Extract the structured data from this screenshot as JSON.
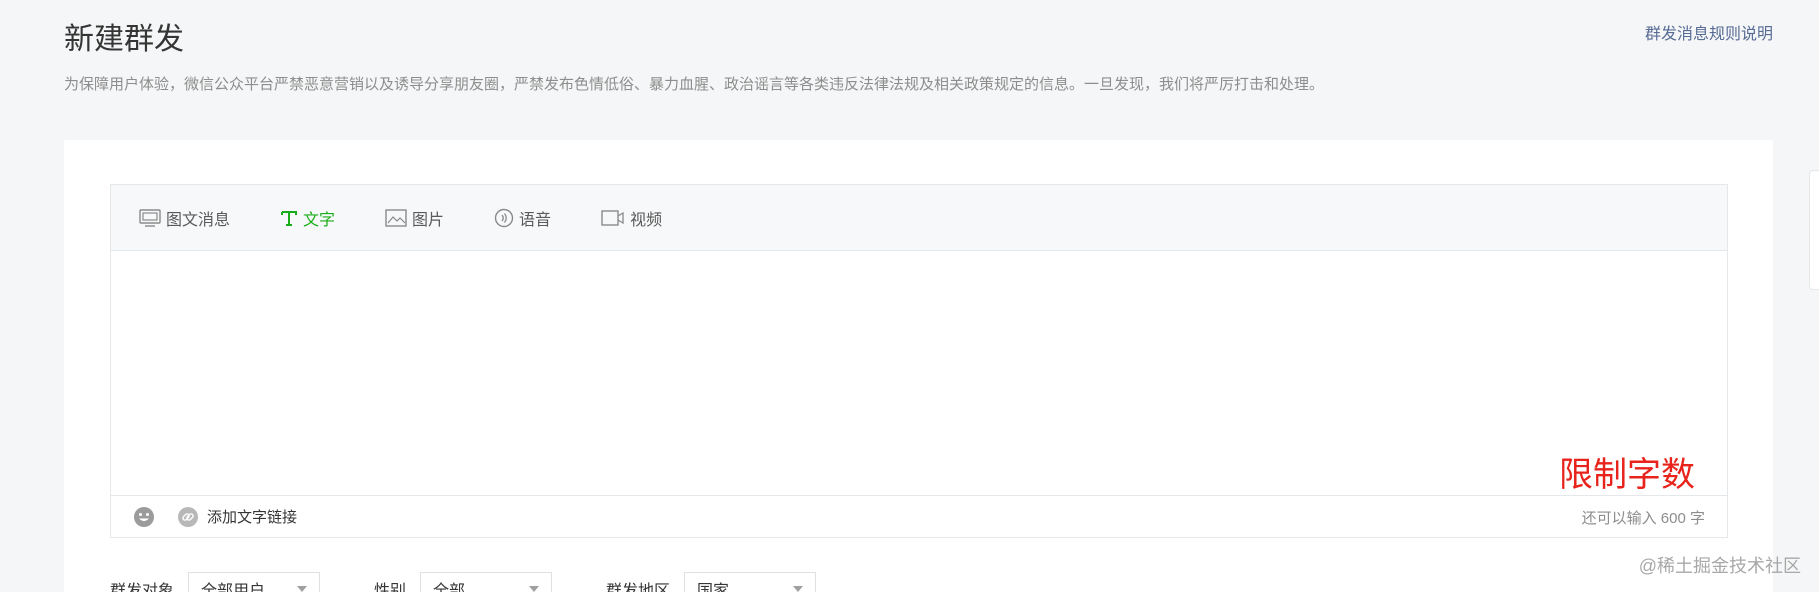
{
  "page": {
    "title": "新建群发",
    "rules_link": "群发消息规则说明",
    "notice": "为保障用户体验，微信公众平台严禁恶意营销以及诱导分享朋友圈，严禁发布色情低俗、暴力血腥、政治谣言等各类违反法律法规及相关政策规定的信息。一旦发现，我们将严厉打击和处理。"
  },
  "tabs": [
    {
      "label": "图文消息",
      "icon": "news-icon",
      "active": false
    },
    {
      "label": "文字",
      "icon": "text-icon",
      "active": true
    },
    {
      "label": "图片",
      "icon": "image-icon",
      "active": false
    },
    {
      "label": "语音",
      "icon": "voice-icon",
      "active": false
    },
    {
      "label": "视频",
      "icon": "video-icon",
      "active": false
    }
  ],
  "editor": {
    "value": "",
    "overlay_label": "限制字数",
    "add_link_label": "添加文字链接",
    "counter": "还可以输入 600 字"
  },
  "filters": [
    {
      "label": "群发对象",
      "value": "全部用户"
    },
    {
      "label": "性别",
      "value": "全部"
    },
    {
      "label": "群发地区",
      "value": "国家"
    }
  ],
  "watermark": "@稀土掘金技术社区",
  "colors": {
    "accent": "#1aad19",
    "link": "#576b95",
    "annotation": "#e8231c"
  }
}
